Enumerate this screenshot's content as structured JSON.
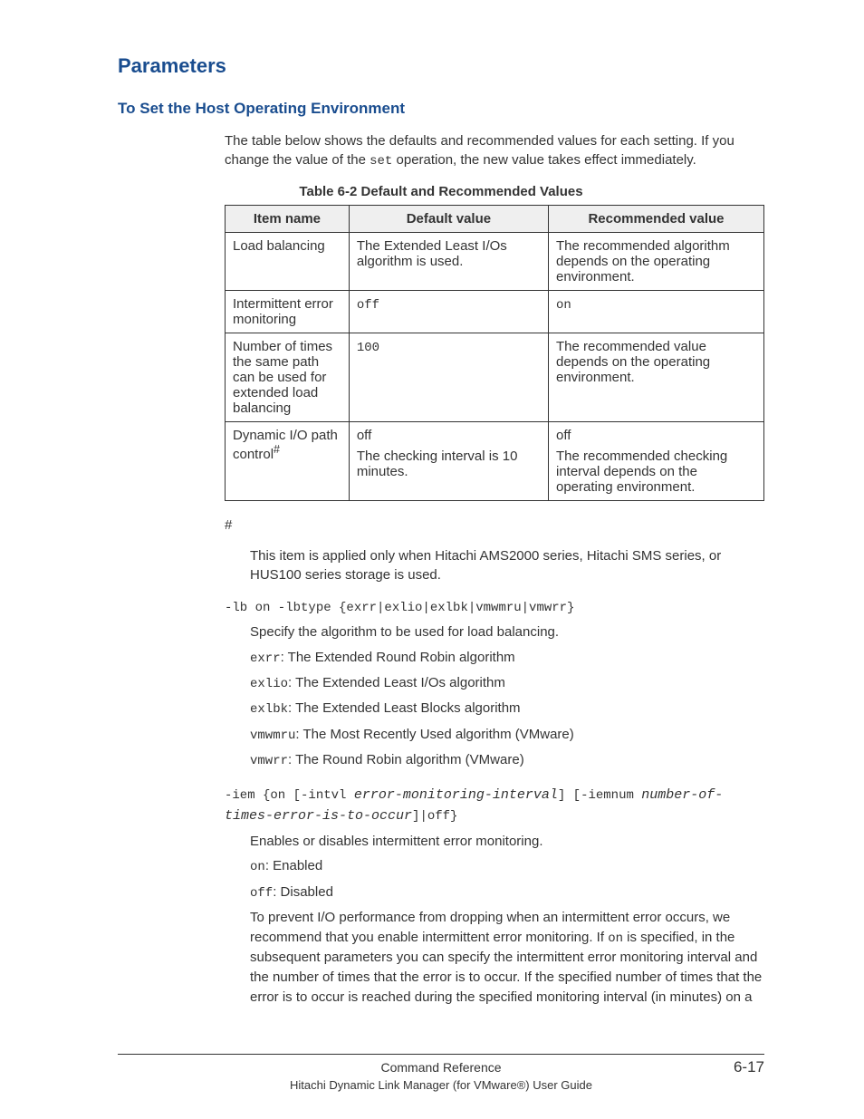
{
  "heading": "Parameters",
  "subheading": "To Set the Host Operating Environment",
  "intro_pre": "The table below shows the defaults and recommended values for each setting. If you change the value of the ",
  "intro_code": "set",
  "intro_post": " operation, the new value takes effect immediately.",
  "table_caption": "Table 6-2 Default and Recommended Values",
  "table": {
    "headers": [
      "Item name",
      "Default value",
      "Recommended value"
    ],
    "rows": [
      {
        "item": "Load balancing",
        "default_text": "The Extended Least I/Os algorithm is used.",
        "rec_text": "The recommended algorithm depends on the operating environment."
      },
      {
        "item": "Intermittent error monitoring",
        "default_code": "off",
        "rec_code": "on"
      },
      {
        "item": "Number of times the same path can be used for extended load balancing",
        "default_code": "100",
        "rec_text": "The recommended value depends on the operating environment."
      },
      {
        "item_html": "Dynamic I/O path control",
        "item_sup": "#",
        "default_text_1": "off",
        "default_text_2": "The checking interval is 10 minutes.",
        "rec_text_1": "off",
        "rec_text_2": "The recommended checking interval depends on the operating environment."
      }
    ]
  },
  "footnote_marker": "#",
  "footnote_text": "This item is applied only when Hitachi AMS2000 series, Hitachi SMS series, or HUS100 series storage is used.",
  "param1": {
    "syntax": "-lb on -lbtype {exrr|exlio|exlbk|vmwmru|vmwrr}",
    "desc": "Specify the algorithm to be used for load balancing.",
    "items": [
      {
        "code": "exrr",
        "text": ": The Extended Round Robin algorithm"
      },
      {
        "code": "exlio",
        "text": ": The Extended Least I/Os algorithm"
      },
      {
        "code": "exlbk",
        "text": ": The Extended Least Blocks algorithm"
      },
      {
        "code": "vmwmru",
        "text": ": The Most Recently Used algorithm (VMware)"
      },
      {
        "code": "vmwrr",
        "text": ": The Round Robin algorithm (VMware)"
      }
    ]
  },
  "param2": {
    "syntax_parts": {
      "p1": "-iem {on [-intvl ",
      "arg1": "error-monitoring-interval",
      "p2": "] [-iemnum ",
      "arg2": "number-of-times-error-is-to-occur",
      "p3": "]|off}"
    },
    "desc": "Enables or disables intermittent error monitoring.",
    "on_code": "on",
    "on_text": ": Enabled",
    "off_code": "off",
    "off_text": ": Disabled",
    "para_pre": "To prevent I/O performance from dropping when an intermittent error occurs, we recommend that you enable intermittent error monitoring. If ",
    "para_code": "on",
    "para_post": " is specified, in the subsequent parameters you can specify the intermittent error monitoring interval and the number of times that the error is to occur. If the specified number of times that the error is to occur is reached during the specified monitoring interval (in minutes) on a"
  },
  "footer": {
    "center1": "Command Reference",
    "page": "6-17",
    "center2": "Hitachi Dynamic Link Manager (for VMware®) User Guide"
  }
}
